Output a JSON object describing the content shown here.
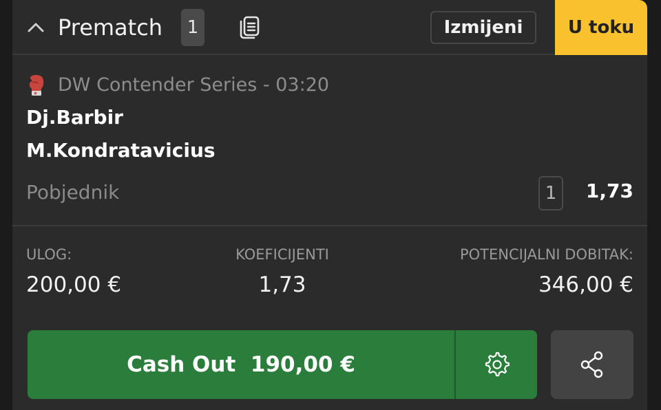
{
  "header": {
    "title": "Prematch",
    "count": "1",
    "edited_label": "Izmijeni",
    "live_label": "U toku"
  },
  "event": {
    "sport_icon": "boxing-glove-icon",
    "name": "DW Contender Series - 03:20",
    "participant1": "Dj.Barbir",
    "participant2": "M.Kondratavicius",
    "market": "Pobjednik",
    "selection": "1",
    "odds": "1,73"
  },
  "summary": {
    "stake_label": "ULOG:",
    "stake_value": "200,00 €",
    "coef_label": "KOEFICIJENTI",
    "coef_value": "1,73",
    "potential_label": "POTENCIJALNI DOBITAK:",
    "potential_value": "346,00 €"
  },
  "actions": {
    "cashout_label": "Cash Out",
    "cashout_value": "190,00 €"
  },
  "colors": {
    "accent_yellow": "#f8c12d",
    "cashout_green": "#2a7d3a",
    "background": "#2b2b2b"
  }
}
